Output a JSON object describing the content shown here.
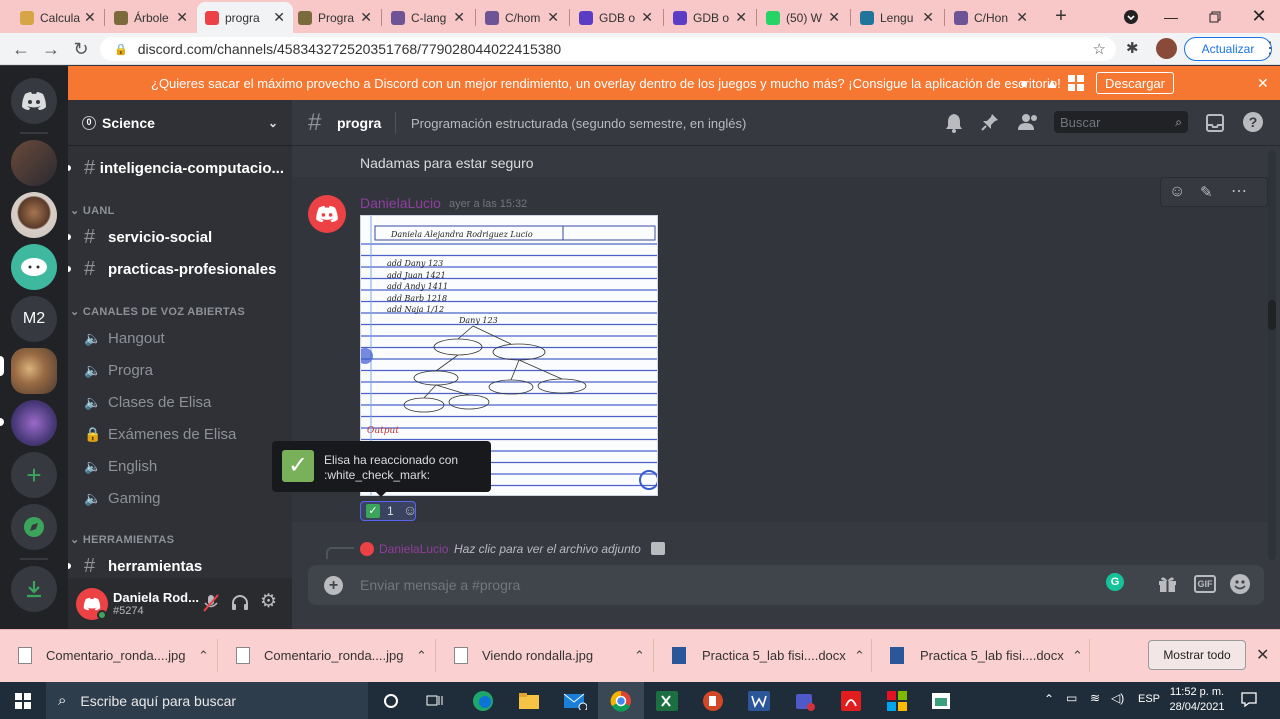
{
  "browser": {
    "tabs": [
      {
        "label": "Calcula",
        "favicon_color": "#d6a646",
        "active": false
      },
      {
        "label": "Árbole",
        "favicon_color": "#7a6a3c",
        "active": false
      },
      {
        "label": "progra",
        "favicon_color": "#ed4245",
        "active": true
      },
      {
        "label": "Progra",
        "favicon_color": "#7a6a3c",
        "active": false
      },
      {
        "label": "C-lang",
        "favicon_color": "#6e5494",
        "active": false
      },
      {
        "label": "C/hom",
        "favicon_color": "#6e5494",
        "active": false
      },
      {
        "label": "GDB o",
        "favicon_color": "#5b3cc4",
        "active": false
      },
      {
        "label": "GDB o",
        "favicon_color": "#5b3cc4",
        "active": false
      },
      {
        "label": "(50) W",
        "favicon_color": "#25d366",
        "active": false
      },
      {
        "label": "Lengu",
        "favicon_color": "#21759b",
        "active": false
      },
      {
        "label": "C/Hon",
        "favicon_color": "#6e5494",
        "active": false
      }
    ],
    "new_tab": "+",
    "url": "discord.com/channels/458343272520351768/779028044022415380",
    "update_button": "Actualizar"
  },
  "banner": {
    "text": "¿Quieres sacar el máximo provecho a Discord con un mejor rendimiento, un overlay dentro de los juegos y mucho más? ¡Consigue la aplicación de escritorio!",
    "download": "Descargar"
  },
  "guilds": {
    "m2_label": "M2",
    "add": "+"
  },
  "server": {
    "name": "Science",
    "badge": "0"
  },
  "channels": {
    "top": [
      {
        "name": "inteligencia-computacio..."
      }
    ],
    "uanl_cat": "UANL",
    "uanl": [
      {
        "name": "servicio-social"
      },
      {
        "name": "practicas-profesionales"
      }
    ],
    "voice_cat": "CANALES DE VOZ ABIERTAS",
    "voice": [
      {
        "name": "Hangout",
        "icon": "speaker"
      },
      {
        "name": "Progra",
        "icon": "speaker"
      },
      {
        "name": "Clases de Elisa",
        "icon": "speaker"
      },
      {
        "name": "Exámenes de Elisa",
        "icon": "lock"
      },
      {
        "name": "English",
        "icon": "speaker"
      },
      {
        "name": "Gaming",
        "icon": "speaker"
      }
    ],
    "tools_cat": "HERRAMIENTAS",
    "tools": [
      {
        "name": "herramientas"
      }
    ]
  },
  "user": {
    "name": "Daniela Rod...",
    "tag": "#5274"
  },
  "chat": {
    "channel": "progra",
    "topic": "Programación estructurada (segundo semestre, en inglés)",
    "search_placeholder": "Buscar",
    "prev_message": "Nadamas para estar seguro",
    "author": "DanielaLucio",
    "author_color": "#8f3fa0",
    "timestamp": "ayer a las 15:32",
    "reaction_count": "1",
    "reply_author": "DanielaLucio",
    "reply_text": "Haz clic para ver el archivo adjunto",
    "composer_placeholder": "Enviar mensaje a #progra",
    "gif_label": "GIF"
  },
  "image_notes": {
    "header": "Daniela Alejandra Rodriguez Lucio",
    "lines": [
      "add Dany 123",
      "add Juan 1421",
      "add Andy 1411",
      "add Barb 1218",
      "add Naja 1/12"
    ],
    "root": "Dany 123",
    "output_label": "Output"
  },
  "toast": {
    "line1": "Elisa ha reaccionado con",
    "line2": ":white_check_mark:"
  },
  "downloads": {
    "items": [
      {
        "name": "Comentario_ronda....jpg",
        "kind": "image"
      },
      {
        "name": "Comentario_ronda....jpg",
        "kind": "image"
      },
      {
        "name": "Viendo rondalla.jpg",
        "kind": "image"
      },
      {
        "name": "Practica 5_lab fisi....docx",
        "kind": "word"
      },
      {
        "name": "Practica 5_lab fisi....docx",
        "kind": "word"
      }
    ],
    "show_all": "Mostrar todo"
  },
  "taskbar": {
    "search_placeholder": "Escribe aquí para buscar",
    "lang": "ESP",
    "time": "11:52 p. m.",
    "date": "28/04/2021"
  }
}
